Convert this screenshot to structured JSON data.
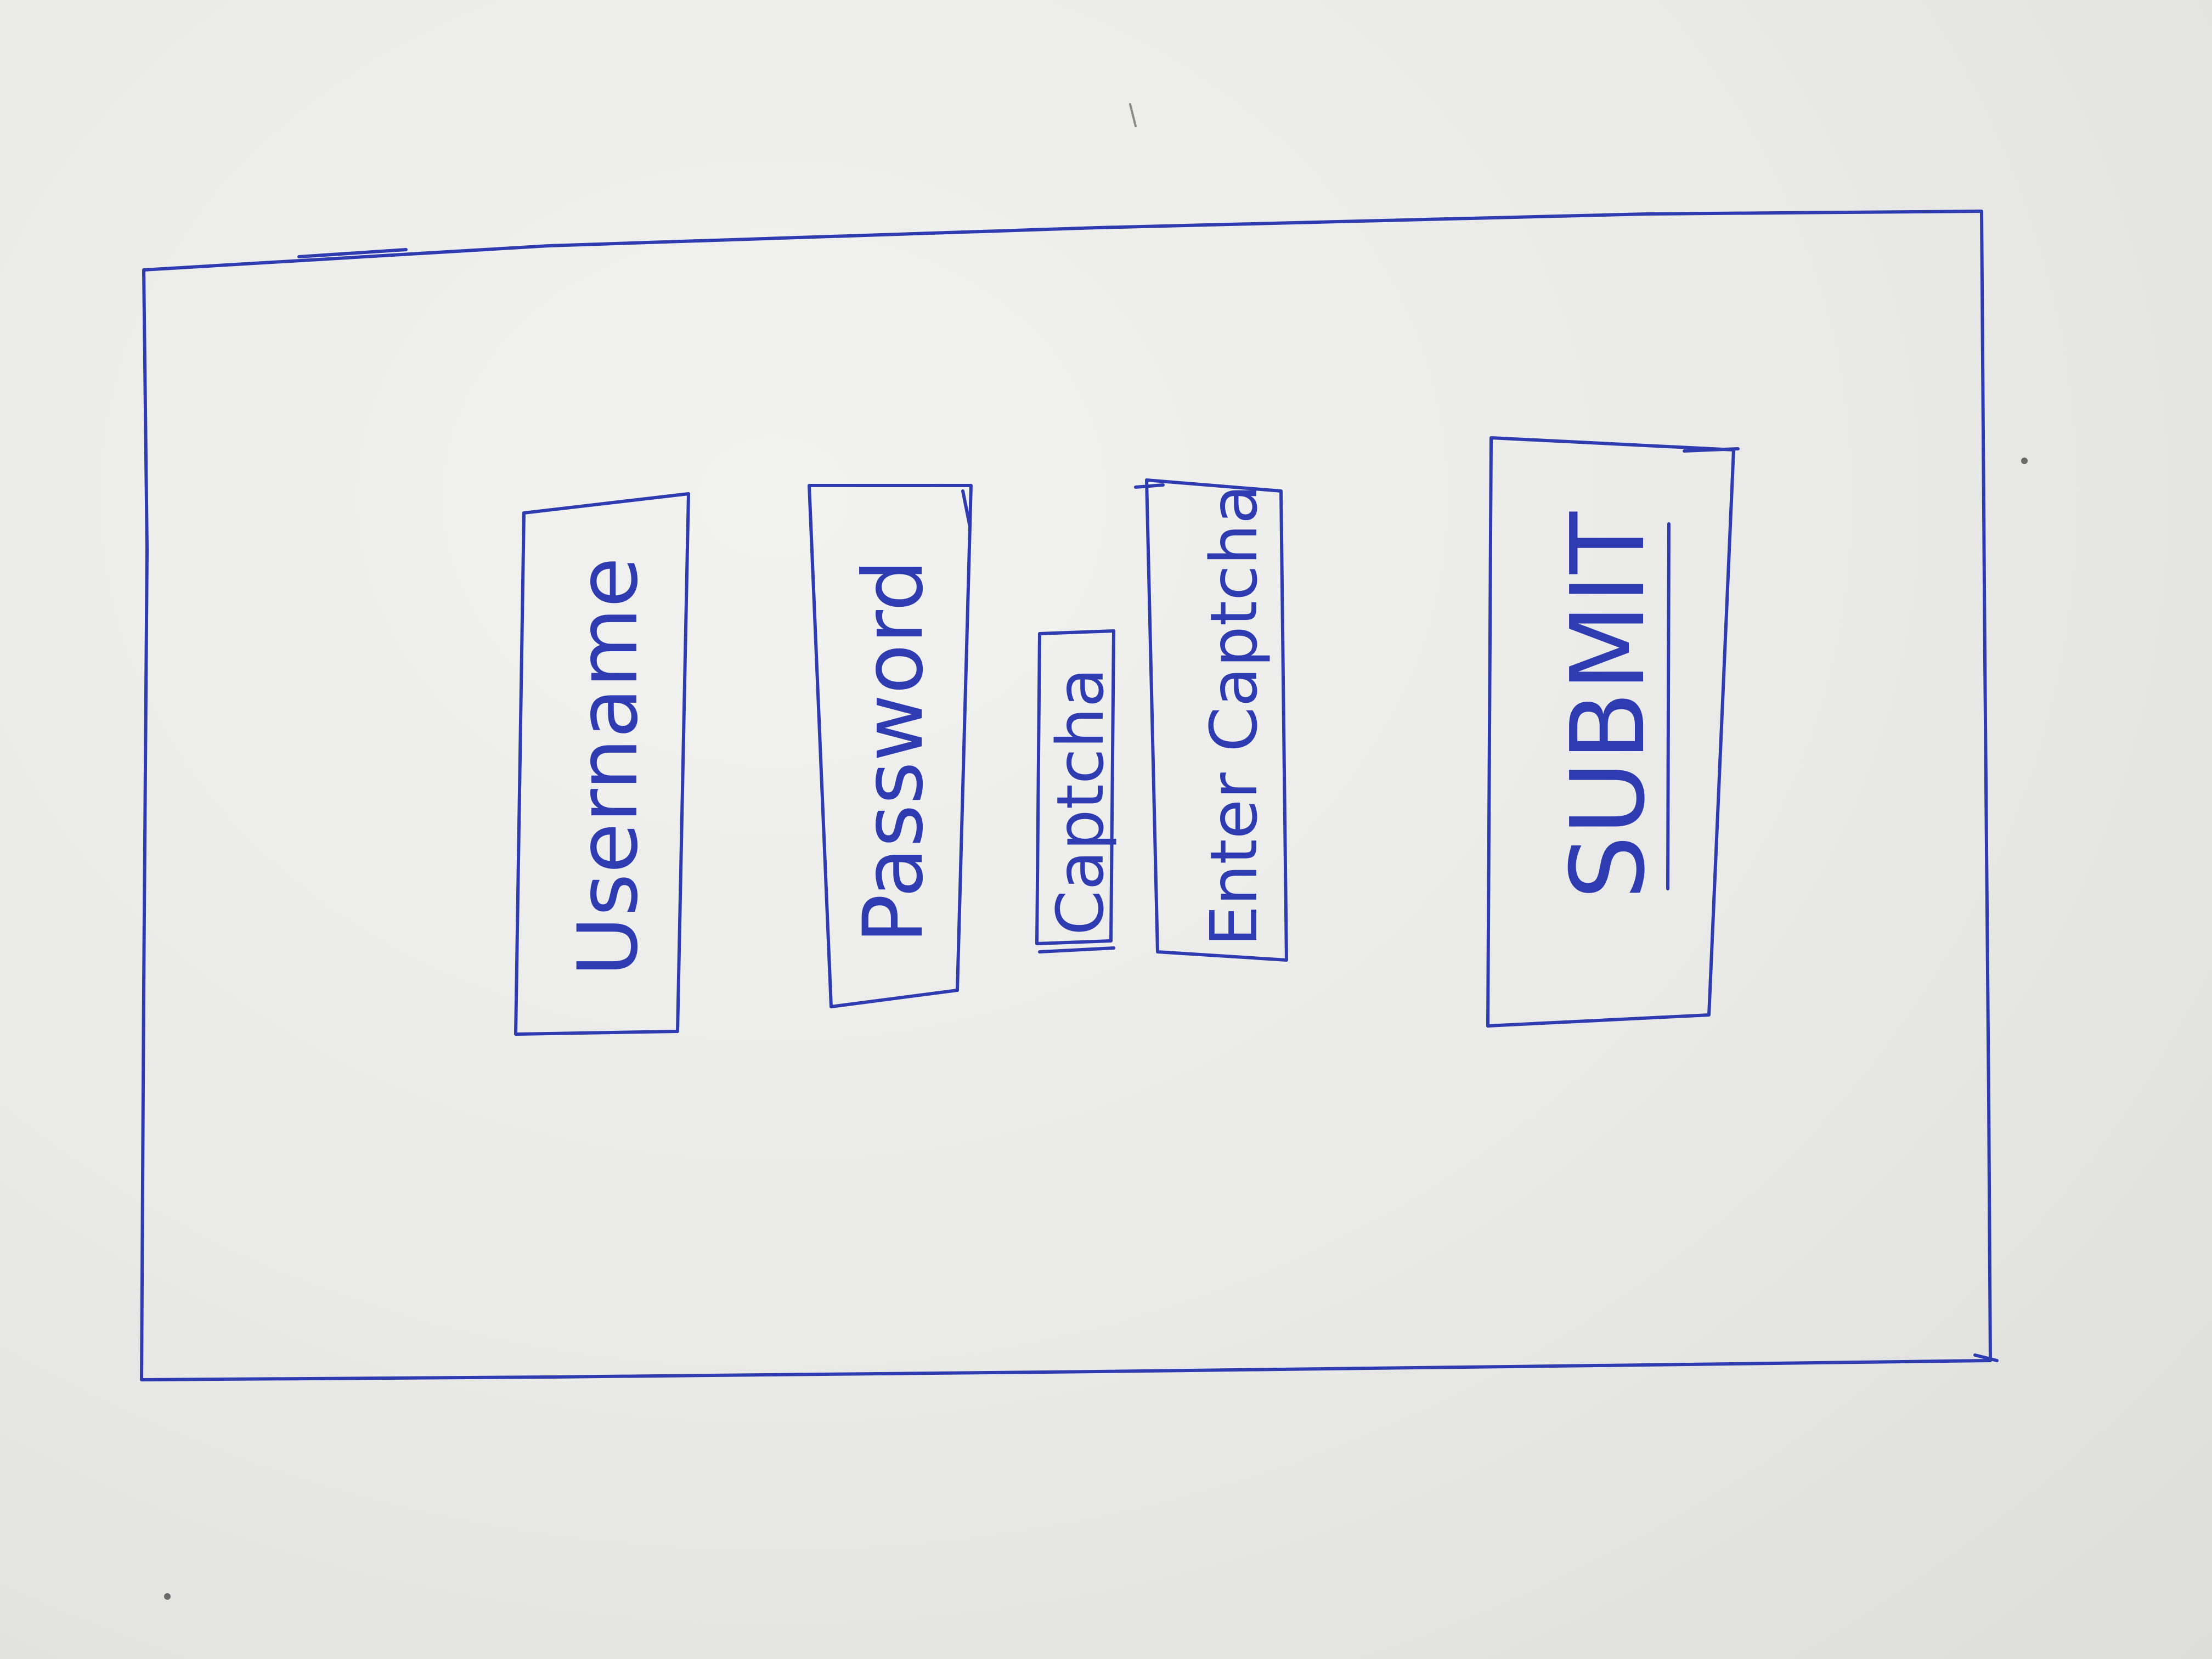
{
  "login_form": {
    "username_label": "Username",
    "password_label": "Password",
    "captcha_label": "Captcha",
    "captcha_input_label": "Enter Captcha",
    "submit_label": "SUBMIT"
  },
  "colors": {
    "ink": "#2f3bb0",
    "paper": "#e9e9e7"
  }
}
